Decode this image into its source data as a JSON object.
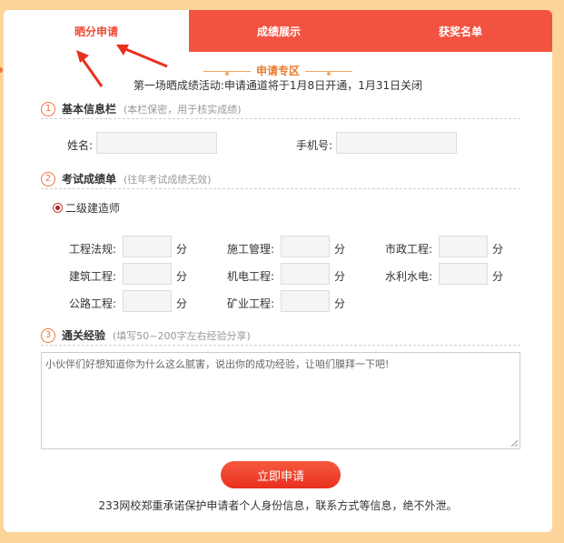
{
  "tabs": [
    {
      "label": "晒分申请",
      "active": true
    },
    {
      "label": "成绩展示",
      "active": false
    },
    {
      "label": "获奖名单",
      "active": false
    }
  ],
  "zone_title": "申请专区",
  "notice": "第一场晒成绩活动:申请通道将于1月8日开通，1月31日关闭",
  "section1": {
    "num": "1",
    "title": "基本信息栏",
    "hint": "(本栏保密，用于核实成绩)"
  },
  "fields": {
    "name_label": "姓名:",
    "phone_label": "手机号:"
  },
  "section2": {
    "num": "2",
    "title": "考试成绩单",
    "hint": "(往年考试成绩无效)"
  },
  "exam_type": "二级建造师",
  "subjects": [
    {
      "label": "工程法规:",
      "unit": "分"
    },
    {
      "label": "施工管理:",
      "unit": "分"
    },
    {
      "label": "市政工程:",
      "unit": "分"
    },
    {
      "label": "建筑工程:",
      "unit": "分"
    },
    {
      "label": "机电工程:",
      "unit": "分"
    },
    {
      "label": "水利水电:",
      "unit": "分"
    },
    {
      "label": "公路工程:",
      "unit": "分"
    },
    {
      "label": "矿业工程:",
      "unit": "分"
    }
  ],
  "section3": {
    "num": "3",
    "title": "通关经验",
    "hint": "(填写50~200字左右经验分享)"
  },
  "experience_placeholder": "小伙伴们好想知道你为什么这么腻害，说出你的成功经验，让咱们膜拜一下吧!",
  "submit_label": "立即申请",
  "footer": "233网校郑重承诺保护申请者个人身份信息，联系方式等信息，绝不外泄。",
  "colors": {
    "accent": "#f25340",
    "orange": "#f0733f",
    "page_bg": "#fdd49a"
  }
}
